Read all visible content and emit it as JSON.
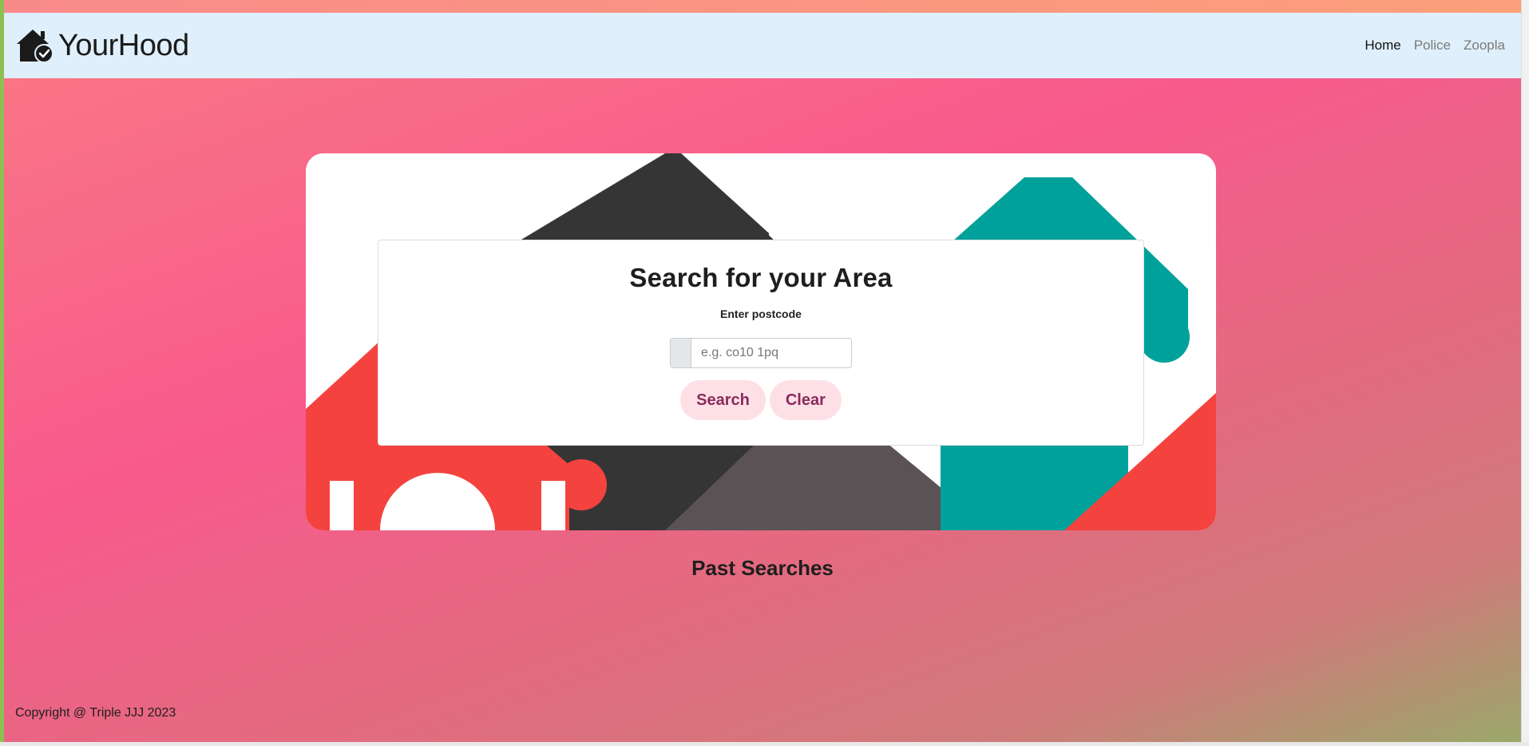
{
  "brand": {
    "name": "YourHood",
    "logo_icon": "house-check-icon"
  },
  "nav": {
    "links": [
      {
        "label": "Home",
        "active": true
      },
      {
        "label": "Police",
        "active": false
      },
      {
        "label": "Zoopla",
        "active": false
      }
    ]
  },
  "search": {
    "title": "Search for your Area",
    "label": "Enter postcode",
    "placeholder": "e.g. co10 1pq",
    "value": "",
    "search_button": "Search",
    "clear_button": "Clear"
  },
  "past_searches": {
    "title": "Past Searches",
    "items": []
  },
  "footer": {
    "copyright": "Copyright @ Triple JJJ 2023"
  },
  "colors": {
    "navbar_bg": "#dfeffb",
    "button_bg": "#fde0e6",
    "button_text": "#8a2a5c",
    "gradient_top": "#fa7a84",
    "gradient_bottom": "#9aa86a"
  }
}
